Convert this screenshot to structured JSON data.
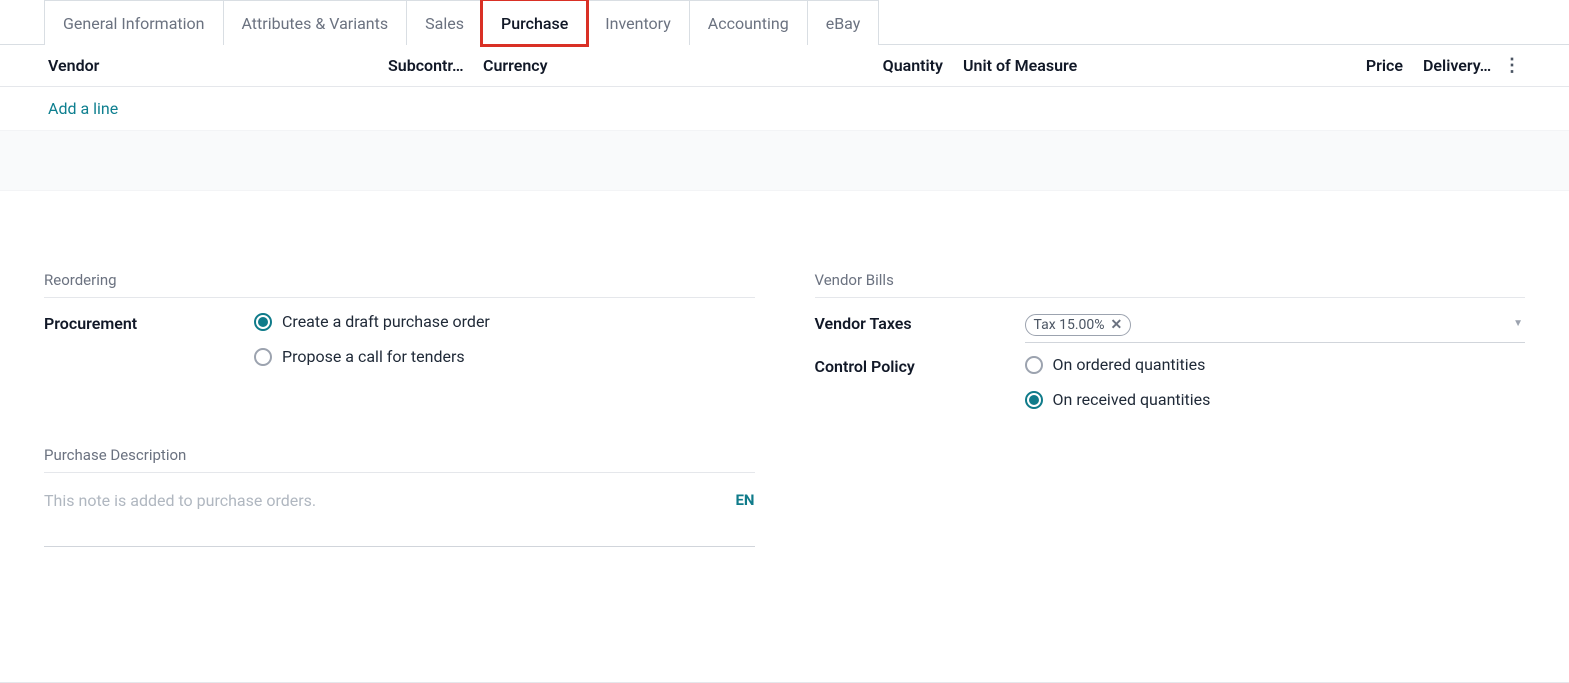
{
  "tabs": {
    "general_information": "General Information",
    "attributes_variants": "Attributes & Variants",
    "sales": "Sales",
    "purchase": "Purchase",
    "inventory": "Inventory",
    "accounting": "Accounting",
    "ebay": "eBay"
  },
  "columns": {
    "vendor": "Vendor",
    "subcontr": "Subcontr…",
    "currency": "Currency",
    "quantity": "Quantity",
    "uom": "Unit of Measure",
    "price": "Price",
    "delivery": "Delivery…"
  },
  "add_line": "Add a line",
  "reordering": {
    "title": "Reordering",
    "procurement_label": "Procurement",
    "options": {
      "create_draft": "Create a draft purchase order",
      "propose_call": "Propose a call for tenders"
    },
    "selected": "create_draft"
  },
  "vendor_bills": {
    "title": "Vendor Bills",
    "vendor_taxes_label": "Vendor Taxes",
    "tax_tag": "Tax 15.00%",
    "control_policy_label": "Control Policy",
    "options": {
      "on_ordered": "On ordered quantities",
      "on_received": "On received quantities"
    },
    "selected": "on_received"
  },
  "purchase_description": {
    "title": "Purchase Description",
    "placeholder": "This note is added to purchase orders.",
    "lang": "EN"
  }
}
